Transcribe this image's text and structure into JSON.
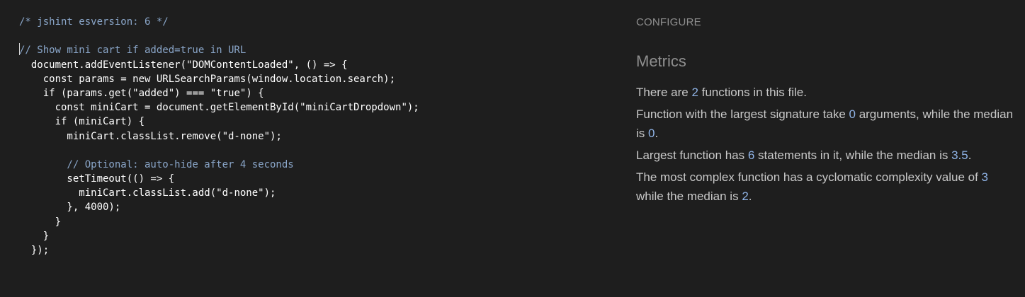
{
  "editor": {
    "lines": [
      [
        {
          "t": "/* jshint esversion: 6 */",
          "c": "comment"
        }
      ],
      [
        {
          "t": "",
          "c": "plain"
        }
      ],
      [
        {
          "t": "// Show mini cart if added=true in URL",
          "c": "comment",
          "caret": true
        }
      ],
      [
        {
          "t": "  document.addEventListener(",
          "c": "plain"
        },
        {
          "t": "\"DOMContentLoaded\"",
          "c": "string"
        },
        {
          "t": ", () => {",
          "c": "plain"
        }
      ],
      [
        {
          "t": "    const params = new URLSearchParams(window.location.search);",
          "c": "plain"
        }
      ],
      [
        {
          "t": "    if (params.get(",
          "c": "plain"
        },
        {
          "t": "\"added\"",
          "c": "string"
        },
        {
          "t": ") === ",
          "c": "plain"
        },
        {
          "t": "\"true\"",
          "c": "string"
        },
        {
          "t": ") {",
          "c": "plain"
        }
      ],
      [
        {
          "t": "      const miniCart = document.getElementById(",
          "c": "plain"
        },
        {
          "t": "\"miniCartDropdown\"",
          "c": "string"
        },
        {
          "t": ");",
          "c": "plain"
        }
      ],
      [
        {
          "t": "      if (miniCart) {",
          "c": "plain"
        }
      ],
      [
        {
          "t": "        miniCart.classList.remove(",
          "c": "plain"
        },
        {
          "t": "\"d-none\"",
          "c": "string"
        },
        {
          "t": ");",
          "c": "plain"
        }
      ],
      [
        {
          "t": "",
          "c": "plain"
        }
      ],
      [
        {
          "t": "        // Optional: auto-hide after 4 seconds",
          "c": "comment"
        }
      ],
      [
        {
          "t": "        setTimeout(() => {",
          "c": "plain"
        }
      ],
      [
        {
          "t": "          miniCart.classList.add(",
          "c": "plain"
        },
        {
          "t": "\"d-none\"",
          "c": "string"
        },
        {
          "t": ");",
          "c": "plain"
        }
      ],
      [
        {
          "t": "        }, 4000);",
          "c": "plain"
        }
      ],
      [
        {
          "t": "      }",
          "c": "plain"
        }
      ],
      [
        {
          "t": "    }",
          "c": "plain"
        }
      ],
      [
        {
          "t": "  });",
          "c": "plain"
        }
      ]
    ]
  },
  "panel": {
    "configure_label": "CONFIGURE",
    "metrics_title": "Metrics",
    "metrics": [
      {
        "parts": [
          "There are ",
          {
            "n": "2"
          },
          " functions in this file."
        ]
      },
      {
        "parts": [
          "Function with the largest signature take ",
          {
            "n": "0"
          },
          " arguments, while the median is ",
          {
            "n": "0"
          },
          "."
        ]
      },
      {
        "parts": [
          "Largest function has ",
          {
            "n": "6"
          },
          " statements in it, while the median is ",
          {
            "n": "3.5"
          },
          "."
        ]
      },
      {
        "parts": [
          "The most complex function has a cyclomatic complexity value of ",
          {
            "n": "3"
          },
          " while the median is ",
          {
            "n": "2"
          },
          "."
        ]
      }
    ]
  },
  "colors": {
    "background": "#1e1e1e",
    "comment": "#8aa6c9",
    "number_highlight": "#8fb3e6",
    "muted_heading": "#8f8f8f",
    "body_text": "#c8c8c8"
  }
}
